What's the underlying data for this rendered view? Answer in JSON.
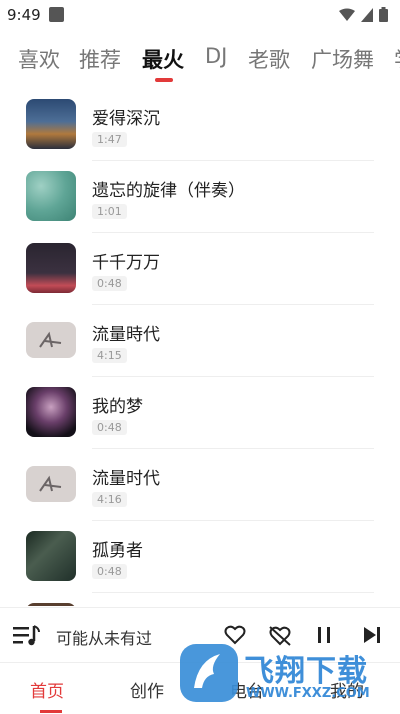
{
  "status": {
    "time": "9:49"
  },
  "tabs": [
    "喜欢",
    "推荐",
    "最火",
    "DJ",
    "老歌",
    "广场舞",
    "学"
  ],
  "songs": [
    {
      "title": "爱得深沉",
      "duration": "1:47"
    },
    {
      "title": "遗忘的旋律（伴奏）",
      "duration": "1:01"
    },
    {
      "title": "千千万万",
      "duration": "0:48"
    },
    {
      "title": "流量時代",
      "duration": "4:15"
    },
    {
      "title": "我的梦",
      "duration": "0:48"
    },
    {
      "title": "流量时代",
      "duration": "4:16"
    },
    {
      "title": "孤勇者",
      "duration": "0:48"
    }
  ],
  "player": {
    "now_playing": "可能从未有过"
  },
  "nav": [
    "首页",
    "创作",
    "电台",
    "我的"
  ],
  "watermark": {
    "main": "飞翔下载",
    "url": "WWW.FXXZ.COM"
  },
  "colors": {
    "accent": "#e23a3a"
  }
}
